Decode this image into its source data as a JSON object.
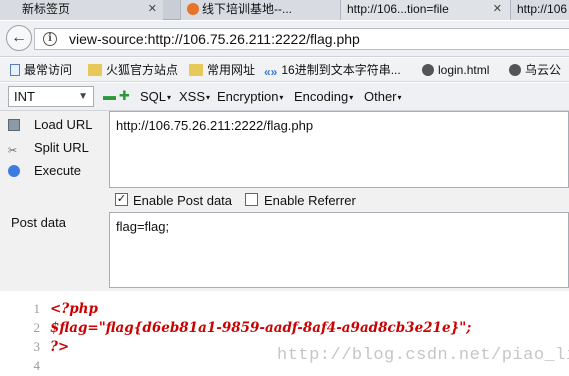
{
  "tabs": [
    {
      "label": "新标签页"
    },
    {
      "label": "线下培训基地--..."
    },
    {
      "label": "http://106...tion=file"
    },
    {
      "label": "http://106"
    }
  ],
  "navbar": {
    "url": "view-source:http://106.75.26.211:2222/flag.php"
  },
  "bookmarks": [
    {
      "label": "最常访问"
    },
    {
      "label": "火狐官方站点"
    },
    {
      "label": "常用网址"
    },
    {
      "label": "16进制到文本字符串..."
    },
    {
      "label": "login.html"
    },
    {
      "label": "乌云公"
    }
  ],
  "hackbar": {
    "select_value": "INT",
    "menu": [
      {
        "label": "SQL"
      },
      {
        "label": "XSS"
      },
      {
        "label": "Encryption"
      },
      {
        "label": "Encoding"
      },
      {
        "label": "Other"
      }
    ],
    "load_url": "Load URL",
    "split_url": "Split URL",
    "execute": "Execute",
    "url_value": "http://106.75.26.211:2222/flag.php",
    "enable_post": "Enable Post data",
    "enable_referrer": "Enable Referrer",
    "post_label": "Post data",
    "post_value": "flag=flag;"
  },
  "source": {
    "lines": [
      {
        "num": "1",
        "text": "<?php"
      },
      {
        "num": "2",
        "text": "$flag=\"flag{d6eb81a1-9859-aadf-8af4-a9ad8cb3e21e}\";"
      },
      {
        "num": "3",
        "text": "?>"
      },
      {
        "num": "4",
        "text": ""
      }
    ],
    "watermark": "http://blog.csdn.net/piao_li"
  },
  "colors": {
    "code": "#cc0000",
    "line_numbers": "#9a9a9a",
    "watermark": "#c6c6c6"
  }
}
